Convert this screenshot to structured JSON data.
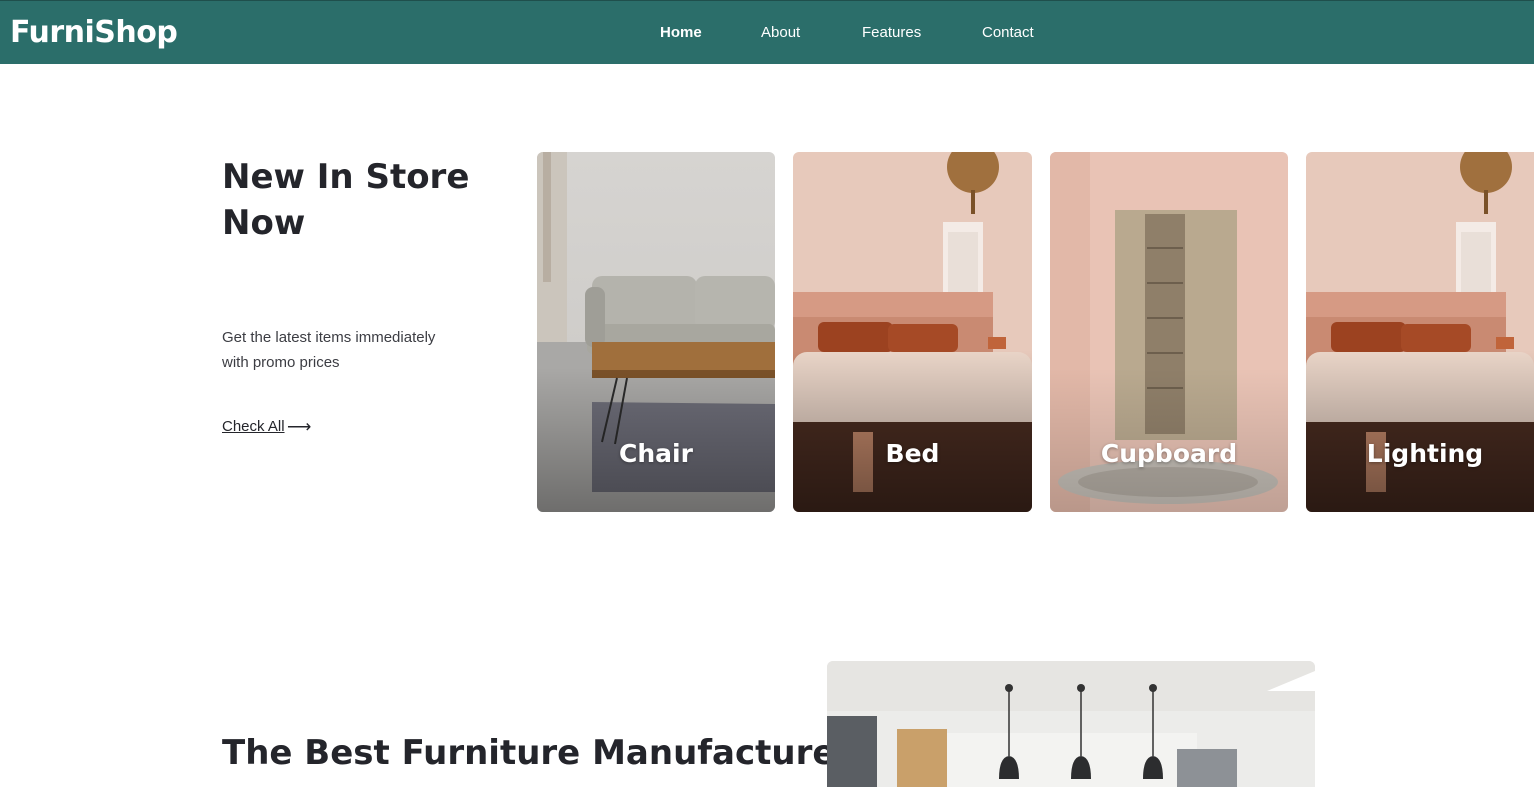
{
  "brand": {
    "name": "FurniShop"
  },
  "nav": {
    "items": [
      {
        "label": "Home",
        "active": true
      },
      {
        "label": "About",
        "active": false
      },
      {
        "label": "Features",
        "active": false
      },
      {
        "label": "Contact",
        "active": false
      }
    ]
  },
  "hero": {
    "heading": "New In Store Now",
    "subtext": "Get the latest items immediately with promo prices",
    "cta_label": "Check All",
    "cta_icon": "arrow-right-icon"
  },
  "categories": [
    {
      "label": "Chair",
      "image": "living-room-sofa-image"
    },
    {
      "label": "Bed",
      "image": "bedroom-bed-image"
    },
    {
      "label": "Cupboard",
      "image": "wooden-cupboard-image"
    },
    {
      "label": "Lighting",
      "image": "bedroom-lighting-image"
    }
  ],
  "section2": {
    "heading": "The Best Furniture Manufacturer Of Your Choice",
    "image": "kitchen-pendant-lights-image"
  },
  "colors": {
    "navbar": "#2b6e6a",
    "text": "#24252b",
    "white": "#ffffff"
  }
}
